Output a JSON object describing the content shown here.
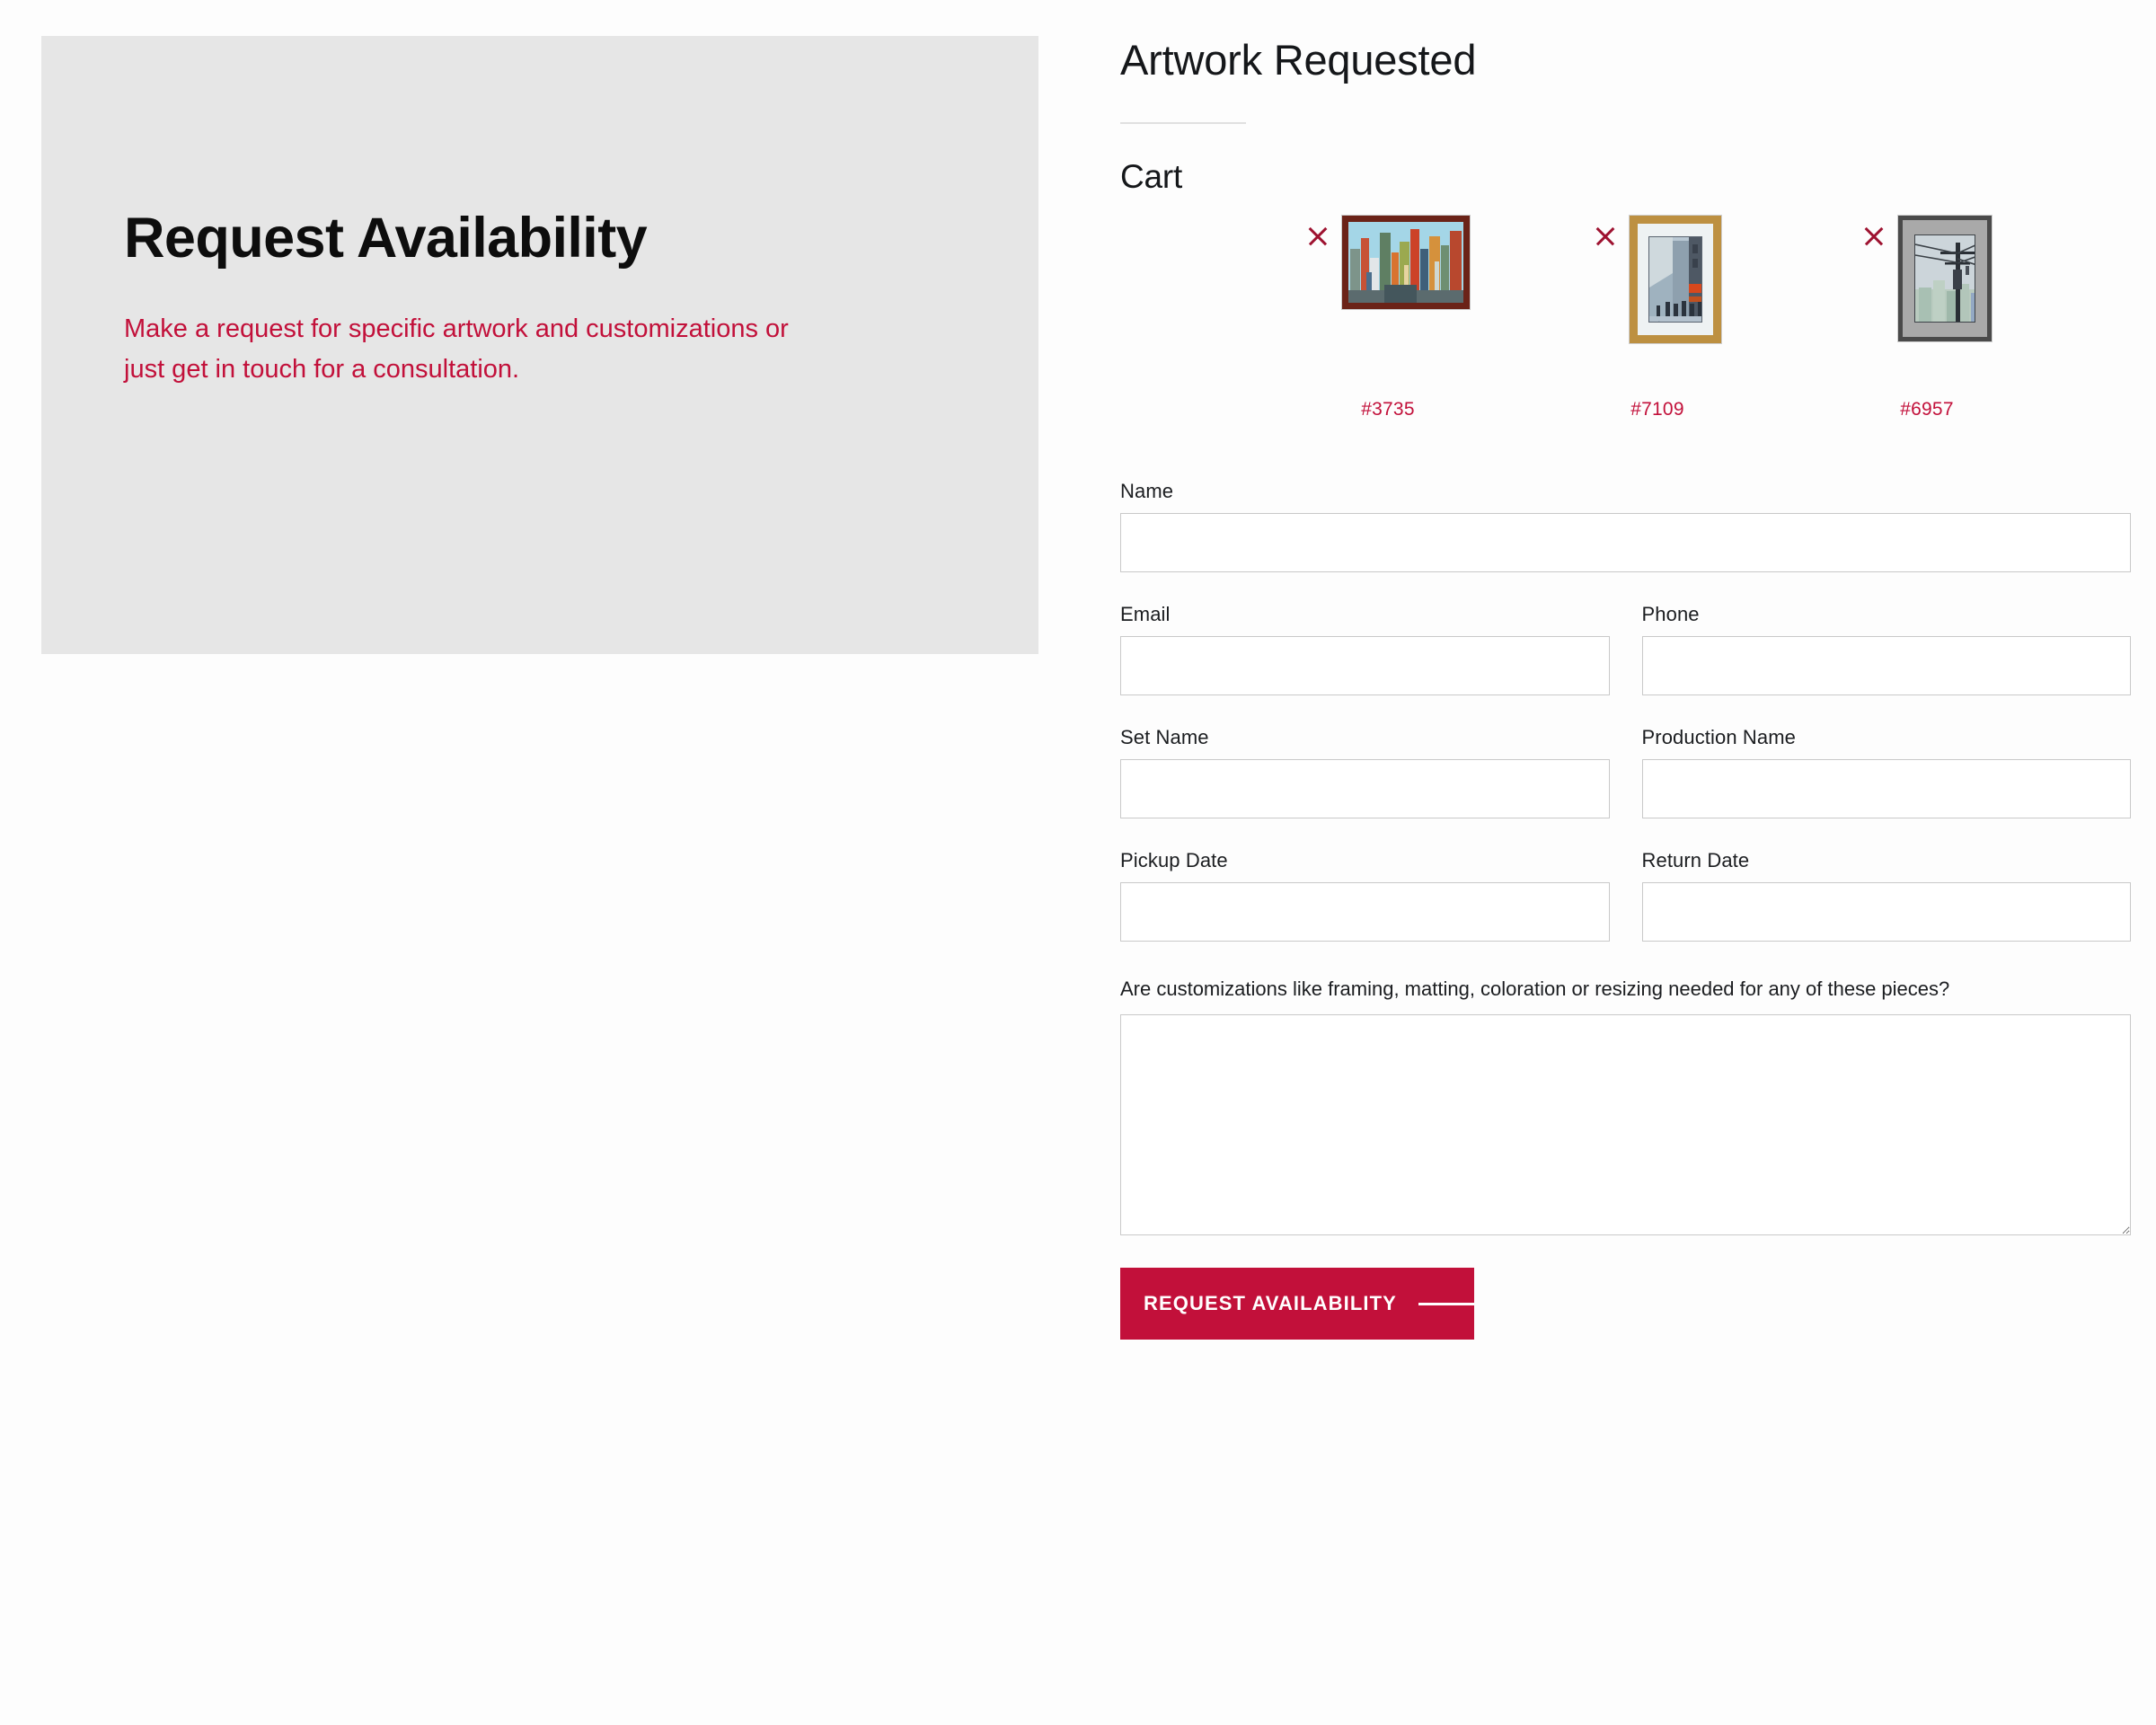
{
  "hero": {
    "title": "Request Availability",
    "subtitle": "Make a request for specific artwork and customizations or just get in touch for a consultation."
  },
  "right": {
    "page_title": "Artwork Requested",
    "cart_title": "Cart"
  },
  "cart": {
    "items": [
      {
        "id": "#3735",
        "remove_icon": "close-icon",
        "art_description": "Abstract colorful cityscape in dark red frame"
      },
      {
        "id": "#7109",
        "remove_icon": "close-icon",
        "art_description": "Street scene watercolor in gold frame with white mat"
      },
      {
        "id": "#6957",
        "remove_icon": "close-icon",
        "art_description": "Utility pole and cityscape watercolor in gray frame with gray mat"
      }
    ]
  },
  "form": {
    "name": {
      "label": "Name",
      "value": "",
      "placeholder": ""
    },
    "email": {
      "label": "Email",
      "value": "",
      "placeholder": ""
    },
    "phone": {
      "label": "Phone",
      "value": "",
      "placeholder": ""
    },
    "set_name": {
      "label": "Set Name",
      "value": "",
      "placeholder": ""
    },
    "production_name": {
      "label": "Production Name",
      "value": "",
      "placeholder": ""
    },
    "pickup_date": {
      "label": "Pickup Date",
      "value": "",
      "placeholder": ""
    },
    "return_date": {
      "label": "Return Date",
      "value": "",
      "placeholder": ""
    },
    "customizations": {
      "label": "Are customizations like framing, matting, coloration or resizing needed for any of these pieces?",
      "value": "",
      "placeholder": ""
    },
    "submit_label": "REQUEST AVAILABILITY"
  },
  "colors": {
    "accent_red": "#c2103a",
    "panel_gray": "#e6e6e6",
    "text_dark": "#15171a",
    "border_gray": "#c9c9c9"
  }
}
